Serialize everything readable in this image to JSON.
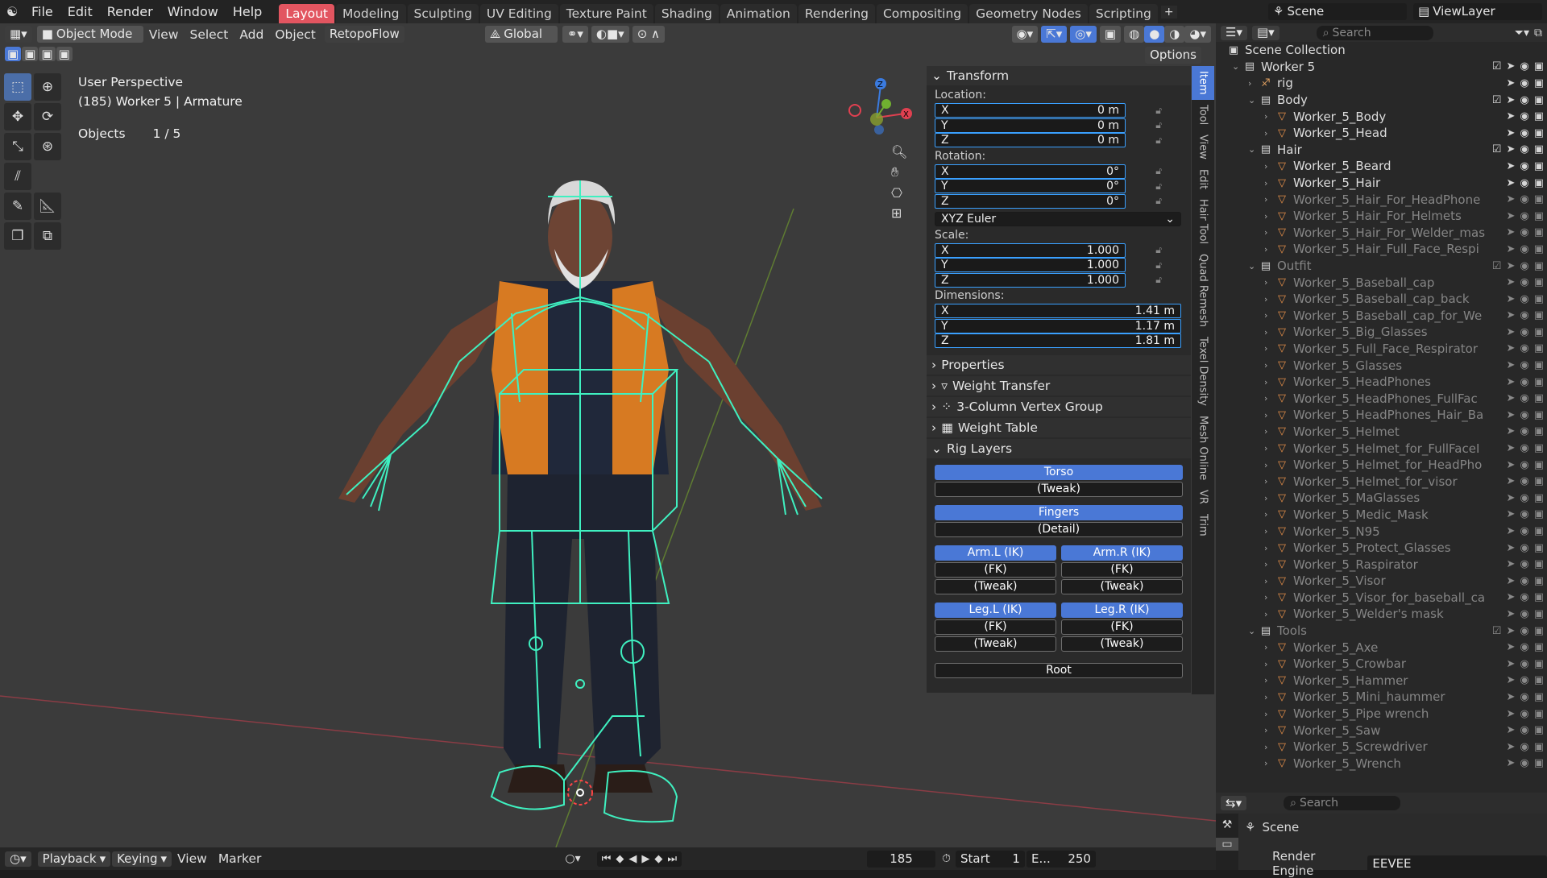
{
  "menus": [
    "File",
    "Edit",
    "Render",
    "Window",
    "Help"
  ],
  "workspace_tabs": [
    "Layout",
    "Modeling",
    "Sculpting",
    "UV Editing",
    "Texture Paint",
    "Shading",
    "Animation",
    "Rendering",
    "Compositing",
    "Geometry Nodes",
    "Scripting"
  ],
  "active_tab": "Layout",
  "scene_name": "Scene",
  "view_layer": "ViewLayer",
  "viewport_header": {
    "mode": "Object Mode",
    "menus": [
      "View",
      "Select",
      "Add",
      "Object"
    ],
    "addon_menu": "RetopoFlow",
    "orientation": "Global",
    "options_label": "Options"
  },
  "overlay": {
    "view_name": "User Perspective",
    "object_info": "(185) Worker 5 | Armature",
    "objects_label": "Objects",
    "objects_count": "1 / 5"
  },
  "npanel": {
    "transform_title": "Transform",
    "location_label": "Location:",
    "location": [
      {
        "axis": "X",
        "value": "0 m"
      },
      {
        "axis": "Y",
        "value": "0 m"
      },
      {
        "axis": "Z",
        "value": "0 m"
      }
    ],
    "rotation_label": "Rotation:",
    "rotation": [
      {
        "axis": "X",
        "value": "0°"
      },
      {
        "axis": "Y",
        "value": "0°"
      },
      {
        "axis": "Z",
        "value": "0°"
      }
    ],
    "rotation_mode": "XYZ Euler",
    "scale_label": "Scale:",
    "scale": [
      {
        "axis": "X",
        "value": "1.000"
      },
      {
        "axis": "Y",
        "value": "1.000"
      },
      {
        "axis": "Z",
        "value": "1.000"
      }
    ],
    "dimensions_label": "Dimensions:",
    "dimensions": [
      {
        "axis": "X",
        "value": "1.41 m"
      },
      {
        "axis": "Y",
        "value": "1.17 m"
      },
      {
        "axis": "Z",
        "value": "1.81 m"
      }
    ],
    "properties_title": "Properties",
    "weight_transfer_title": "Weight Transfer",
    "vertex_group_title": "3-Column Vertex Group",
    "weight_table_title": "Weight Table",
    "rig_layers_title": "Rig Layers",
    "rig": {
      "torso": "Torso",
      "torso_tweak": "(Tweak)",
      "fingers": "Fingers",
      "fingers_detail": "(Detail)",
      "arm_l_ik": "Arm.L (IK)",
      "arm_r_ik": "Arm.R (IK)",
      "arm_l_fk": "(FK)",
      "arm_r_fk": "(FK)",
      "arm_l_tweak": "(Tweak)",
      "arm_r_tweak": "(Tweak)",
      "leg_l_ik": "Leg.L (IK)",
      "leg_r_ik": "Leg.R (IK)",
      "leg_l_fk": "(FK)",
      "leg_r_fk": "(FK)",
      "leg_l_tweak": "(Tweak)",
      "leg_r_tweak": "(Tweak)",
      "root": "Root"
    }
  },
  "side_tabs": [
    "Item",
    "Tool",
    "View",
    "Edit",
    "Hair Tool",
    "Quad Remesh",
    "Texel Density",
    "Mesh Online",
    "VR",
    "Trim"
  ],
  "outliner": {
    "search_placeholder": "Search",
    "root": "Scene Collection",
    "rows": [
      {
        "label": "Worker 5",
        "indent": 1,
        "type": "collection",
        "expanded": true,
        "checked": true,
        "dim": false
      },
      {
        "label": "rig",
        "indent": 2,
        "type": "armature",
        "expanded": false,
        "checked": true,
        "dim": false
      },
      {
        "label": "Body",
        "indent": 2,
        "type": "collection",
        "expanded": true,
        "checked": true,
        "dim": false
      },
      {
        "label": "Worker_5_Body",
        "indent": 3,
        "type": "mesh",
        "dim": false
      },
      {
        "label": "Worker_5_Head",
        "indent": 3,
        "type": "mesh",
        "dim": false
      },
      {
        "label": "Hair",
        "indent": 2,
        "type": "collection",
        "expanded": true,
        "checked": true,
        "dim": false
      },
      {
        "label": "Worker_5_Beard",
        "indent": 3,
        "type": "mesh",
        "dim": false
      },
      {
        "label": "Worker_5_Hair",
        "indent": 3,
        "type": "mesh",
        "dim": false
      },
      {
        "label": "Worker_5_Hair_For_HeadPhone",
        "indent": 3,
        "type": "mesh",
        "dim": true
      },
      {
        "label": "Worker_5_Hair_For_Helmets",
        "indent": 3,
        "type": "mesh",
        "dim": true
      },
      {
        "label": "Worker_5_Hair_For_Welder_mas",
        "indent": 3,
        "type": "mesh",
        "dim": true
      },
      {
        "label": "Worker_5_Hair_Full_Face_Respi",
        "indent": 3,
        "type": "mesh",
        "dim": true
      },
      {
        "label": "Outfit",
        "indent": 2,
        "type": "collection",
        "expanded": true,
        "checked": true,
        "dim": true
      },
      {
        "label": "Worker_5_Baseball_cap",
        "indent": 3,
        "type": "mesh",
        "dim": true
      },
      {
        "label": "Worker_5_Baseball_cap_back",
        "indent": 3,
        "type": "mesh",
        "dim": true
      },
      {
        "label": "Worker_5_Baseball_cap_for_We",
        "indent": 3,
        "type": "mesh",
        "dim": true
      },
      {
        "label": "Worker_5_Big_Glasses",
        "indent": 3,
        "type": "mesh",
        "dim": true
      },
      {
        "label": "Worker_5_Full_Face_Respirator",
        "indent": 3,
        "type": "mesh",
        "dim": true
      },
      {
        "label": "Worker_5_Glasses",
        "indent": 3,
        "type": "mesh",
        "dim": true
      },
      {
        "label": "Worker_5_HeadPhones",
        "indent": 3,
        "type": "mesh",
        "dim": true
      },
      {
        "label": "Worker_5_HeadPhones_FullFac",
        "indent": 3,
        "type": "mesh",
        "dim": true
      },
      {
        "label": "Worker_5_HeadPhones_Hair_Ba",
        "indent": 3,
        "type": "mesh",
        "dim": true
      },
      {
        "label": "Worker_5_Helmet",
        "indent": 3,
        "type": "mesh",
        "dim": true
      },
      {
        "label": "Worker_5_Helmet_for_FullFaceI",
        "indent": 3,
        "type": "mesh",
        "dim": true
      },
      {
        "label": "Worker_5_Helmet_for_HeadPho",
        "indent": 3,
        "type": "mesh",
        "dim": true
      },
      {
        "label": "Worker_5_Helmet_for_visor",
        "indent": 3,
        "type": "mesh",
        "dim": true
      },
      {
        "label": "Worker_5_MaGlasses",
        "indent": 3,
        "type": "mesh",
        "dim": true
      },
      {
        "label": "Worker_5_Medic_Mask",
        "indent": 3,
        "type": "mesh",
        "dim": true
      },
      {
        "label": "Worker_5_N95",
        "indent": 3,
        "type": "mesh",
        "dim": true
      },
      {
        "label": "Worker_5_Protect_Glasses",
        "indent": 3,
        "type": "mesh",
        "dim": true
      },
      {
        "label": "Worker_5_Raspirator",
        "indent": 3,
        "type": "mesh",
        "dim": true
      },
      {
        "label": "Worker_5_Visor",
        "indent": 3,
        "type": "mesh",
        "dim": true
      },
      {
        "label": "Worker_5_Visor_for_baseball_ca",
        "indent": 3,
        "type": "mesh",
        "dim": true
      },
      {
        "label": "Worker_5_Welder's mask",
        "indent": 3,
        "type": "mesh",
        "dim": true
      },
      {
        "label": "Tools",
        "indent": 2,
        "type": "collection",
        "expanded": true,
        "checked": true,
        "dim": true
      },
      {
        "label": "Worker_5_Axe",
        "indent": 3,
        "type": "mesh",
        "dim": true
      },
      {
        "label": "Worker_5_Crowbar",
        "indent": 3,
        "type": "mesh",
        "dim": true
      },
      {
        "label": "Worker_5_Hammer",
        "indent": 3,
        "type": "mesh",
        "dim": true
      },
      {
        "label": "Worker_5_Mini_haummer",
        "indent": 3,
        "type": "mesh",
        "dim": true
      },
      {
        "label": "Worker_5_Pipe wrench",
        "indent": 3,
        "type": "mesh",
        "dim": true
      },
      {
        "label": "Worker_5_Saw",
        "indent": 3,
        "type": "mesh",
        "dim": true
      },
      {
        "label": "Worker_5_Screwdriver",
        "indent": 3,
        "type": "mesh",
        "dim": true
      },
      {
        "label": "Worker_5_Wrench",
        "indent": 3,
        "type": "mesh",
        "dim": true
      }
    ]
  },
  "properties_editor": {
    "search_placeholder": "Search",
    "scene_label": "Scene",
    "render_engine_label": "Render Engine",
    "render_engine_value": "EEVEE"
  },
  "timeline": {
    "playback": "Playback",
    "keying": "Keying",
    "view": "View",
    "marker": "Marker",
    "current_frame": "185",
    "start_label": "Start",
    "start_value": "1",
    "end_label": "E...",
    "end_value": "250"
  },
  "colors": {
    "accent": "#4a78d6",
    "active_tab": "#e25560",
    "bone": "#3ff0c0"
  }
}
